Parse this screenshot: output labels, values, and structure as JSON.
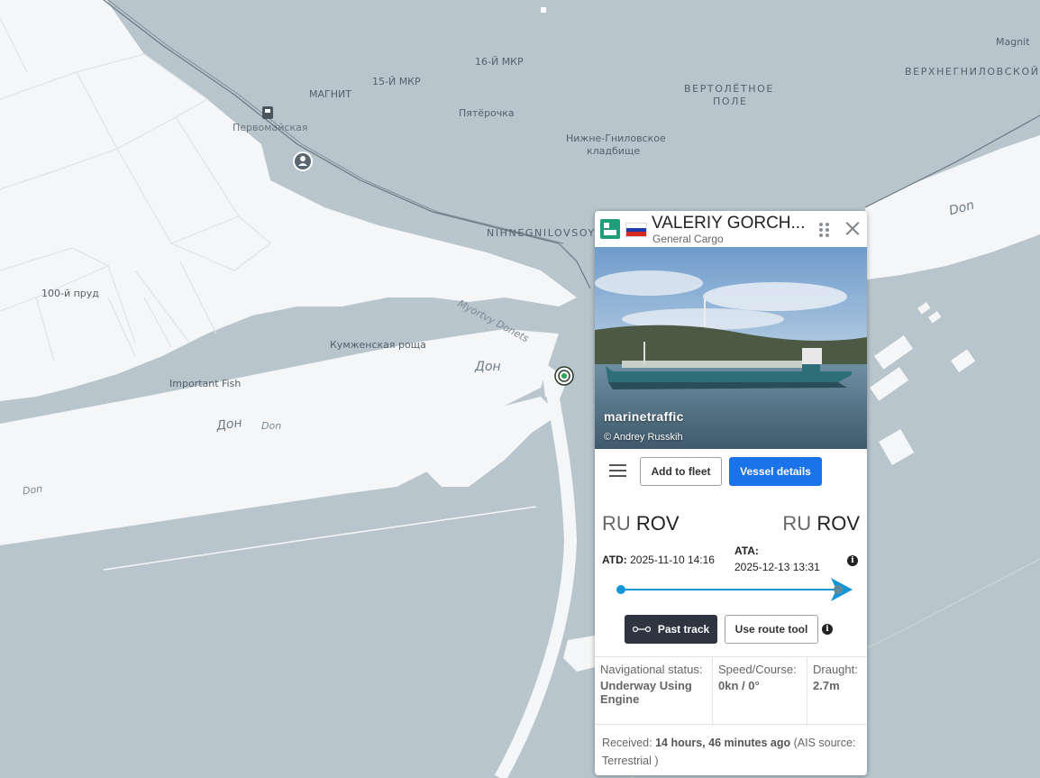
{
  "map": {
    "colors": {
      "water": "#b8c5cd",
      "land": "#f5f6f7",
      "road": "#ffffff",
      "rail": "#6b7680"
    },
    "place_labels": [
      {
        "key": "magnit_en",
        "text": "Magnit"
      },
      {
        "key": "verkhnegnilovskoy",
        "text": "ВЕРХНЕГНИЛОВСКОЙ"
      },
      {
        "key": "mkr16",
        "text": "16-Й МКР"
      },
      {
        "key": "mkr15",
        "text": "15-Й МКР"
      },
      {
        "key": "magnit_ru",
        "text": "МАГНИТ"
      },
      {
        "key": "pervomaiskaya",
        "text": "Первомайская"
      },
      {
        "key": "pyaterochka",
        "text": "Пятёрочка"
      },
      {
        "key": "vertoletnoe1",
        "text": "ВЕРТОЛЁТНОЕ"
      },
      {
        "key": "vertoletnoe2",
        "text": "ПОЛЕ"
      },
      {
        "key": "cemetery1",
        "text": "Нижне-Гниловское"
      },
      {
        "key": "cemetery2",
        "text": "кладбище"
      },
      {
        "key": "nihnegnilovsoy",
        "text": "NIHNEGNILOVSOY"
      },
      {
        "key": "myortvy",
        "text": "Myortvy Donets"
      },
      {
        "key": "pond100",
        "text": "100-й пруд"
      },
      {
        "key": "kumzhenskaya",
        "text": "Кумженская роща"
      },
      {
        "key": "importantfish",
        "text": "Important Fish"
      },
      {
        "key": "don_ru_center",
        "text": "Дон"
      },
      {
        "key": "don_ru_left",
        "text": "Дон"
      },
      {
        "key": "don_en_small1",
        "text": "Don"
      },
      {
        "key": "don_en_small2",
        "text": "Don"
      },
      {
        "key": "don_en_right",
        "text": "Don"
      }
    ],
    "icons": [
      "train-station-icon",
      "person-poi-icon",
      "vessel-position-icon"
    ]
  },
  "popup": {
    "vessel_name": "VALERIY GORCH...",
    "vessel_type": "General Cargo",
    "type_icon": "general-cargo-icon",
    "flag": {
      "country": "Russia",
      "colors": [
        "#ffffff",
        "#1c3faa",
        "#d52b1e"
      ]
    },
    "photo": {
      "brand": "marinetraffic",
      "credit": "© Andrey Russkih"
    },
    "actions": {
      "add_to_fleet": "Add to fleet",
      "vessel_details": "Vessel details"
    },
    "departure": {
      "country": "RU",
      "port": "ROV",
      "label": "ATD:",
      "time": "2025-11-10 14:16"
    },
    "arrival": {
      "country": "RU",
      "port": "ROV",
      "label": "ATA:",
      "time": "2025-12-13 13:31"
    },
    "voyage_progress": 0.92,
    "track": {
      "past_track": "Past track",
      "route_tool": "Use route tool"
    },
    "stats": {
      "nav_status_label": "Navigational status:",
      "nav_status_value": "Underway Using Engine",
      "speed_label": "Speed/Course:",
      "speed_value": "0kn / 0°",
      "draught_label": "Draught:",
      "draught_value": "2.7m"
    },
    "received": {
      "prefix": "Received:",
      "age": "14 hours, 46 minutes ago",
      "source": "(AIS source: Terrestrial )"
    }
  }
}
